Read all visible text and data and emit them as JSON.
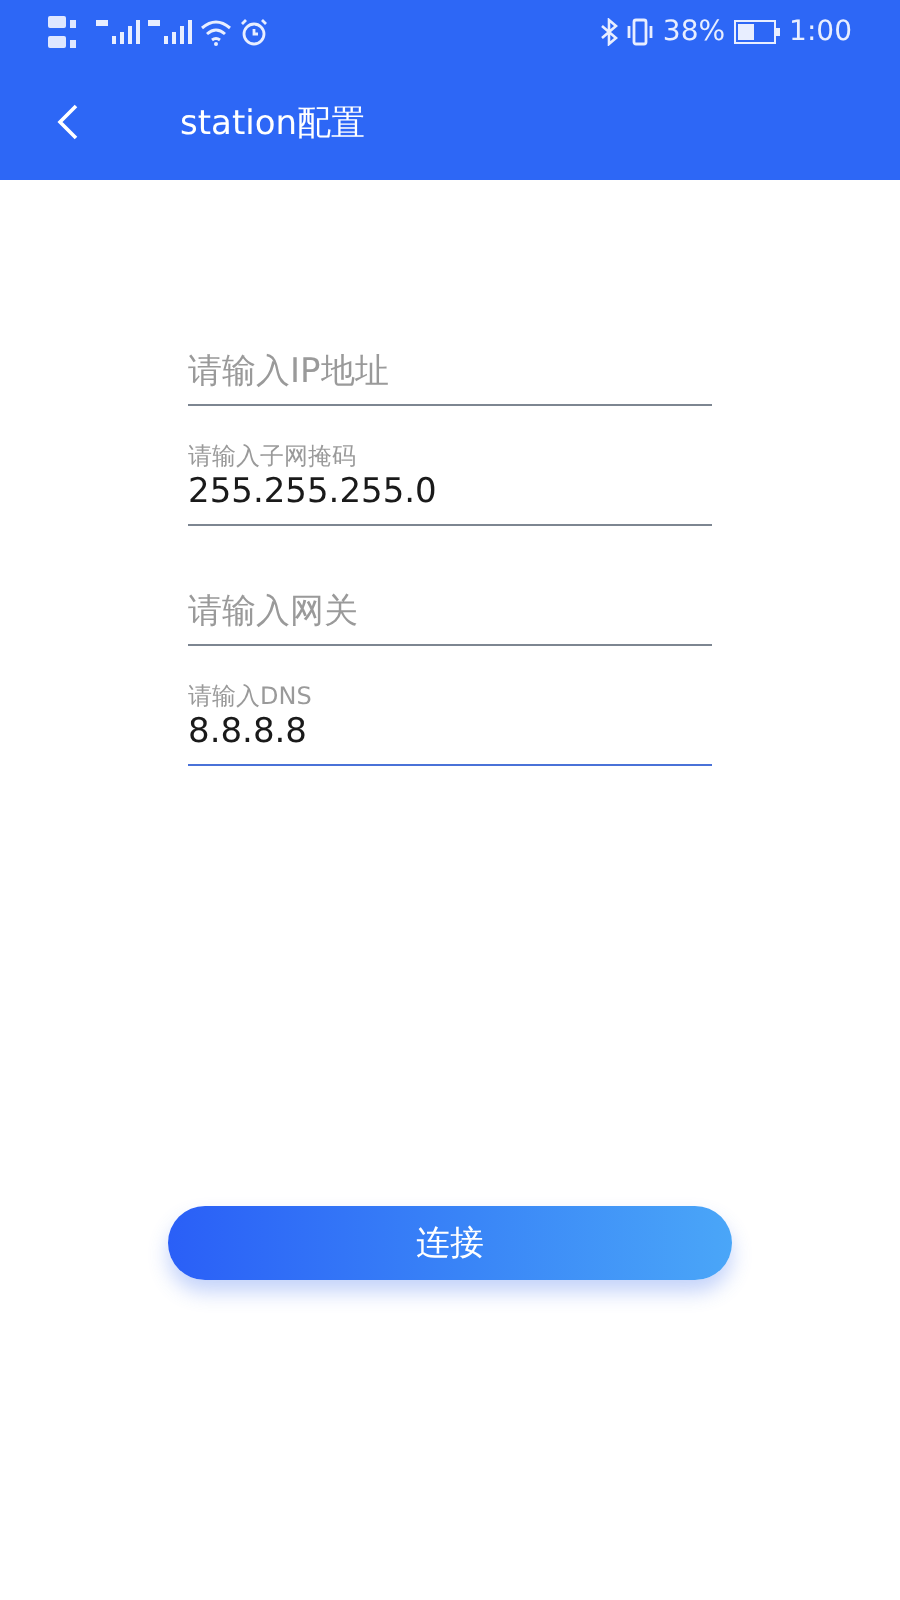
{
  "status_bar": {
    "battery": "38%",
    "time": "1:00"
  },
  "header": {
    "title": "station配置"
  },
  "fields": [
    {
      "placeholder": "请输入IP地址",
      "focused": false
    },
    {
      "placeholder": "请输入子网掩码",
      "value": "255.255.255.0",
      "focused": false
    },
    {
      "placeholder": "请输入网关",
      "focused": false
    },
    {
      "placeholder": "请输入DNS",
      "value": "8.8.8.8",
      "focused": true
    }
  ],
  "button": {
    "label": "连接"
  }
}
